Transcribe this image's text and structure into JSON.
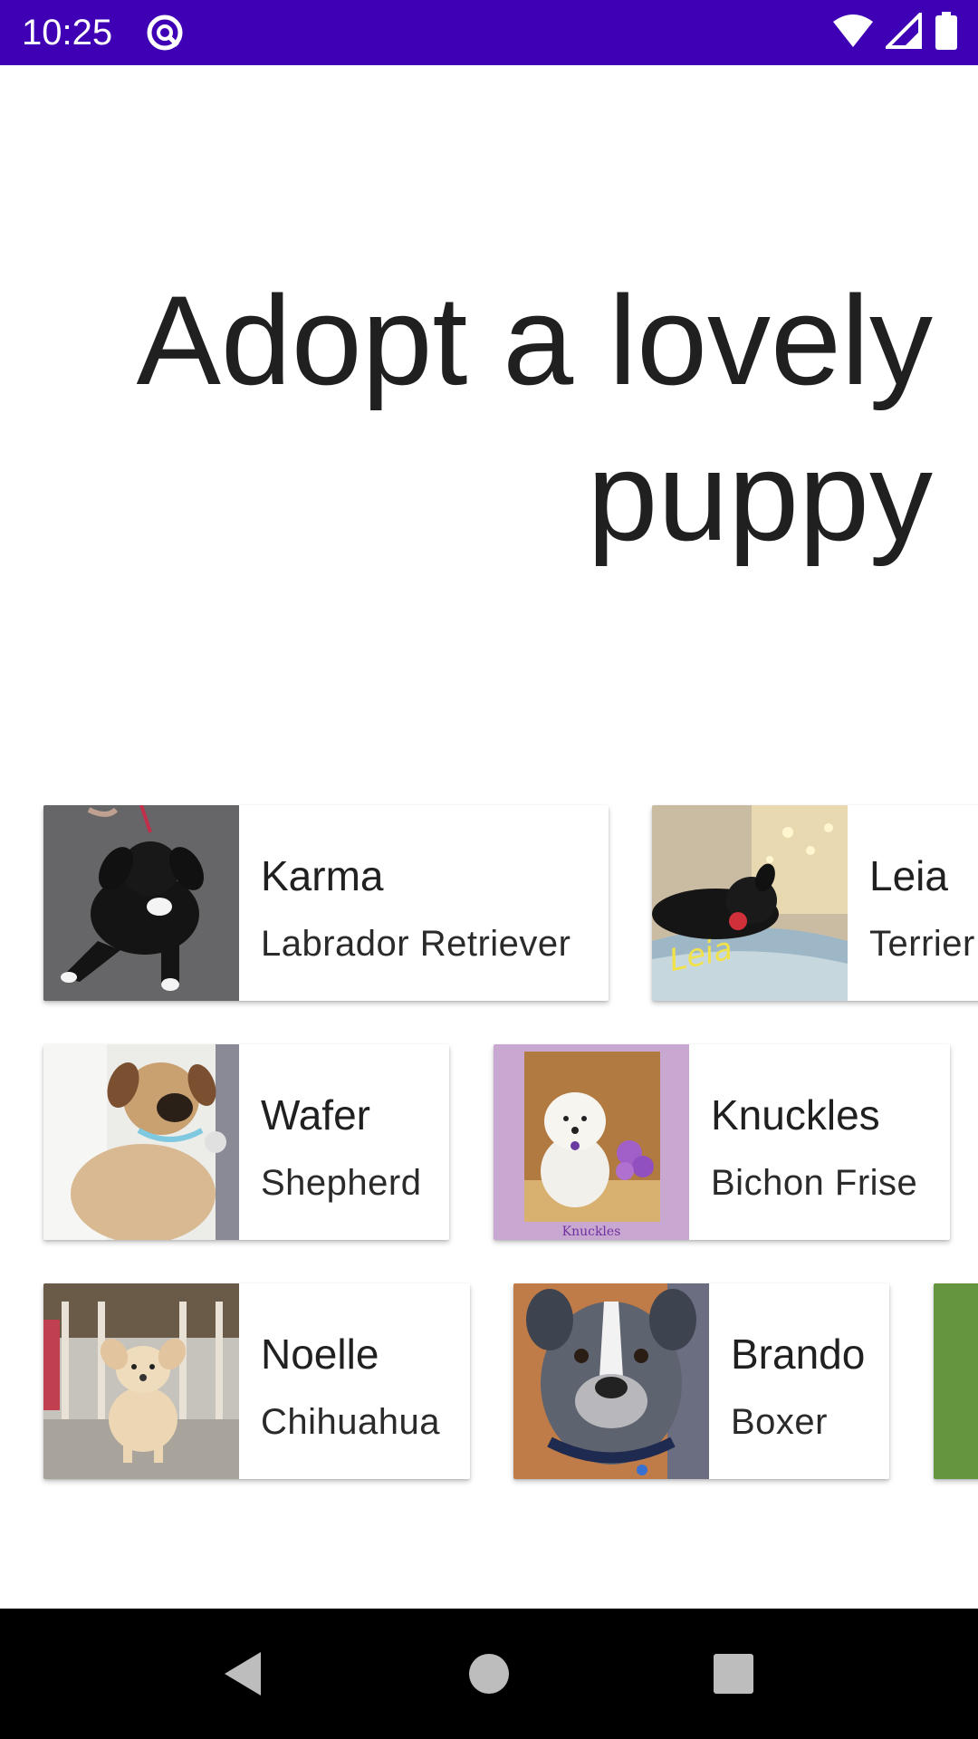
{
  "status_bar": {
    "time": "10:25",
    "icons": [
      "data-saver-icon",
      "wifi-icon",
      "cell-signal-icon",
      "battery-icon"
    ],
    "background": "#3f00b5"
  },
  "headline": {
    "line1": "Adopt a lovely",
    "line2": "puppy"
  },
  "puppies": [
    {
      "name": "Karma",
      "breed": "Labrador Retriever",
      "photo": "black-puppy-photo"
    },
    {
      "name": "Leia",
      "breed": "Terrier",
      "photo": "black-puppy-on-blanket-photo",
      "photo_caption": "Leia"
    },
    {
      "name": "Wafer",
      "breed": "Shepherd",
      "photo": "tan-puppy-photo"
    },
    {
      "name": "Knuckles",
      "breed": "Bichon Frise",
      "photo": "white-puppy-photo",
      "photo_caption": "Knuckles"
    },
    {
      "name": "Noelle",
      "breed": "Chihuahua",
      "photo": "cream-puppy-photo"
    },
    {
      "name": "Brando",
      "breed": "Boxer",
      "photo": "gray-pitbull-puppy-photo"
    }
  ],
  "nav_bar": {
    "buttons": [
      "back",
      "home",
      "recents"
    ]
  }
}
